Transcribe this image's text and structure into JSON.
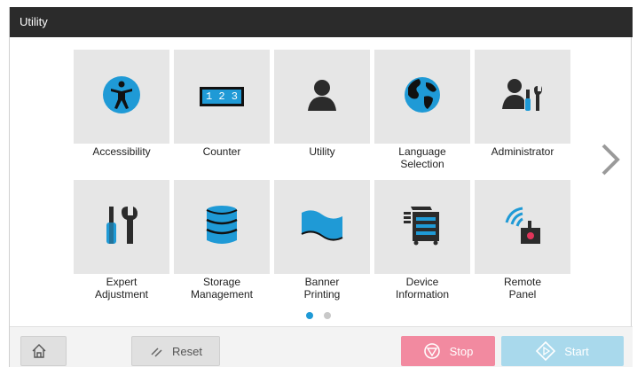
{
  "window": {
    "title": "Utility"
  },
  "tiles": [
    {
      "label": "Accessibility",
      "icon": "accessibility-icon"
    },
    {
      "label": "Counter",
      "icon": "counter-icon",
      "counter_text": "1 2 3"
    },
    {
      "label": "Utility",
      "icon": "user-icon"
    },
    {
      "label": "Language\nSelection",
      "icon": "globe-icon"
    },
    {
      "label": "Administrator",
      "icon": "administrator-icon"
    },
    {
      "label": "Expert\nAdjustment",
      "icon": "tools-icon"
    },
    {
      "label": "Storage\nManagement",
      "icon": "database-icon"
    },
    {
      "label": "Banner\nPrinting",
      "icon": "banner-icon"
    },
    {
      "label": "Device\nInformation",
      "icon": "printer-icon"
    },
    {
      "label": "Remote\nPanel",
      "icon": "remote-panel-icon"
    }
  ],
  "pager": {
    "page_count": 2,
    "current_page": 1
  },
  "footer": {
    "reset_label": "Reset",
    "stop_label": "Stop",
    "start_label": "Start"
  },
  "colors": {
    "accent_blue": "#1f9ad6",
    "dark_icon": "#2b2b2b",
    "stop": "#f28aa0",
    "start": "#a9d9ec",
    "titlebar": "#2b2b2b"
  }
}
